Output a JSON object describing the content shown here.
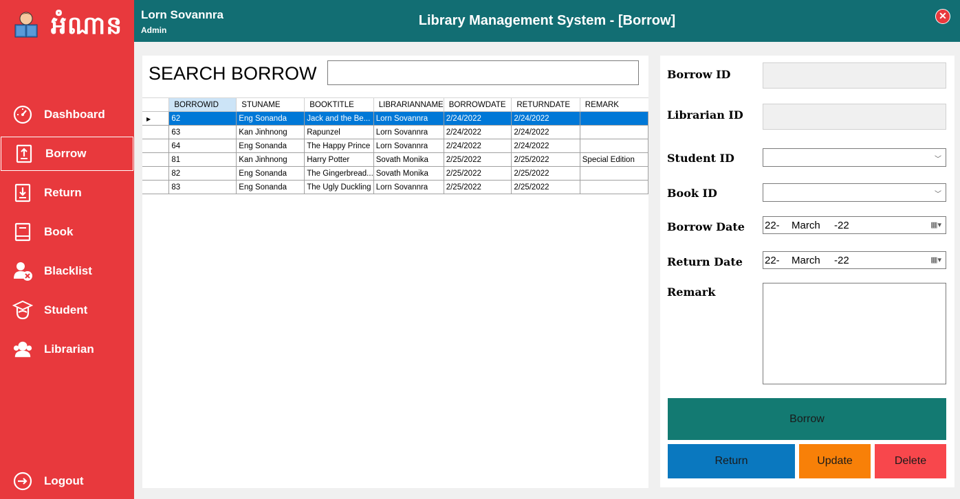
{
  "sidebar": {
    "logo_text": "អំណាន",
    "items": [
      {
        "label": "Dashboard",
        "icon": "dashboard-icon"
      },
      {
        "label": "Borrow",
        "icon": "borrow-icon"
      },
      {
        "label": "Return",
        "icon": "return-icon"
      },
      {
        "label": "Book",
        "icon": "book-icon"
      },
      {
        "label": "Blacklist",
        "icon": "blacklist-icon"
      },
      {
        "label": "Student",
        "icon": "student-icon"
      },
      {
        "label": "Librarian",
        "icon": "librarian-icon"
      }
    ],
    "logout": {
      "label": "Logout",
      "icon": "logout-icon"
    }
  },
  "header": {
    "user_name": "Lorn Sovannra",
    "user_role": "Admin",
    "title": "Library Management System - [Borrow]",
    "close": "✕"
  },
  "search": {
    "label": "SEARCH BORROW",
    "value": ""
  },
  "grid": {
    "columns": [
      "BORROWID",
      "STUNAME",
      "BOOKTITLE",
      "LIBRARIANNAME",
      "BORROWDATE",
      "RETURNDATE",
      "REMARK"
    ],
    "rows": [
      [
        "62",
        "Eng Sonanda",
        "Jack and the Be...",
        "Lorn Sovannra",
        "2/24/2022",
        "2/24/2022",
        ""
      ],
      [
        "63",
        "Kan Jinhnong",
        "Rapunzel",
        "Lorn Sovannra",
        "2/24/2022",
        "2/24/2022",
        ""
      ],
      [
        "64",
        "Eng Sonanda",
        "The Happy Prince",
        "Lorn Sovannra",
        "2/24/2022",
        "2/24/2022",
        ""
      ],
      [
        "81",
        "Kan Jinhnong",
        "Harry Potter",
        "Sovath Monika",
        "2/25/2022",
        "2/25/2022",
        "Special Edition"
      ],
      [
        "82",
        "Eng Sonanda",
        "The Gingerbread...",
        "Sovath Monika",
        "2/25/2022",
        "2/25/2022",
        ""
      ],
      [
        "83",
        "Eng Sonanda",
        "The Ugly Duckling",
        "Lorn Sovannra",
        "2/25/2022",
        "2/25/2022",
        ""
      ]
    ],
    "selected_row": 0,
    "row_marker": "▶"
  },
  "form": {
    "borrow_id_label": "Borrow ID",
    "librarian_id_label": "Librarian ID",
    "student_id_label": "Student ID",
    "book_id_label": "Book ID",
    "borrow_date_label": "Borrow Date",
    "return_date_label": "Return Date",
    "remark_label": "Remark",
    "borrow_date": {
      "day": "22-",
      "month": "March",
      "year": "-22"
    },
    "return_date": {
      "day": "22-",
      "month": "March",
      "year": "-22"
    }
  },
  "buttons": {
    "borrow": "Borrow",
    "return": "Return",
    "update": "Update",
    "delete": "Delete"
  },
  "colors": {
    "sidebar": "#e8393d",
    "header": "#126e73",
    "borrow_btn": "#137a72",
    "return_btn": "#0a78bf",
    "update_btn": "#f88008",
    "delete_btn": "#f8474c",
    "grid_selection": "#0078d7"
  }
}
